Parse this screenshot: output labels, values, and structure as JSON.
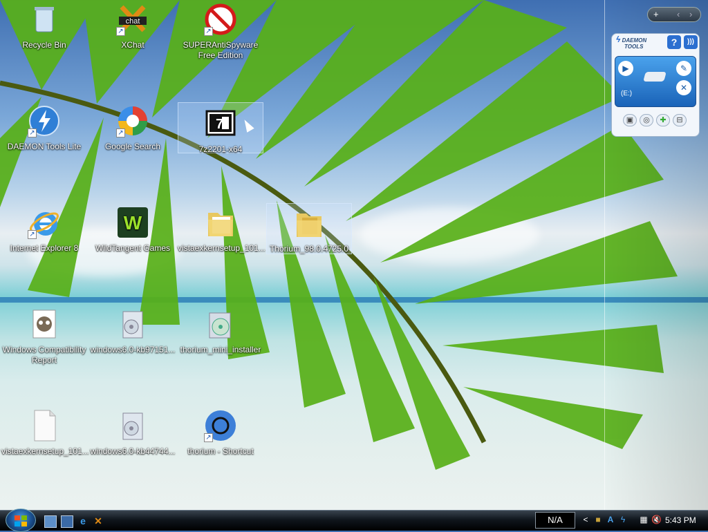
{
  "desktop": {
    "icons": [
      {
        "label": "Recycle Bin"
      },
      {
        "label": "XChat"
      },
      {
        "label": "SUPERAntiSpyware Free Edition"
      },
      {
        "label": "DAEMON Tools Lite"
      },
      {
        "label": "Google Search"
      },
      {
        "label": "7z2201-x64"
      },
      {
        "label": "Internet Explorer 8"
      },
      {
        "label": "WildTangent Games"
      },
      {
        "label": "vistaexkernsetup_101..."
      },
      {
        "label": "Thorium_98.0.4725.0"
      },
      {
        "label": "Windows Compatibility Report"
      },
      {
        "label": "windows6.0-kb97151..."
      },
      {
        "label": "thorium_mini_installer"
      },
      {
        "label": "vistaexkernsetup_101..."
      },
      {
        "label": "windows6.0-kb44744..."
      },
      {
        "label": "thorium - Shortcut"
      }
    ]
  },
  "sidebar": {
    "controls": {
      "add": "+",
      "prev": "‹",
      "next": "›"
    },
    "gadget": {
      "title_line1": "DAEMON",
      "title_line2": "TOOLS",
      "help": "?",
      "drive": "(E:)"
    }
  },
  "taskbar": {
    "tray_text": "N/A",
    "clock": "5:43 PM",
    "chevron": "<"
  },
  "colors": {
    "taskbar": "#10161d",
    "start_orb": "#1a4f8e",
    "gadget_blue": "#1a63b8"
  },
  "icons_semantic": [
    "recycle-bin-icon",
    "xchat-icon",
    "superantispyware-icon",
    "daemon-tools-icon",
    "google-search-icon",
    "7zip-installer-icon",
    "internet-explorer-icon",
    "wildtangent-icon",
    "folder-icon",
    "folder-icon",
    "compatibility-report-icon",
    "installer-icon",
    "installer-icon",
    "file-icon",
    "installer-icon",
    "thorium-icon"
  ]
}
